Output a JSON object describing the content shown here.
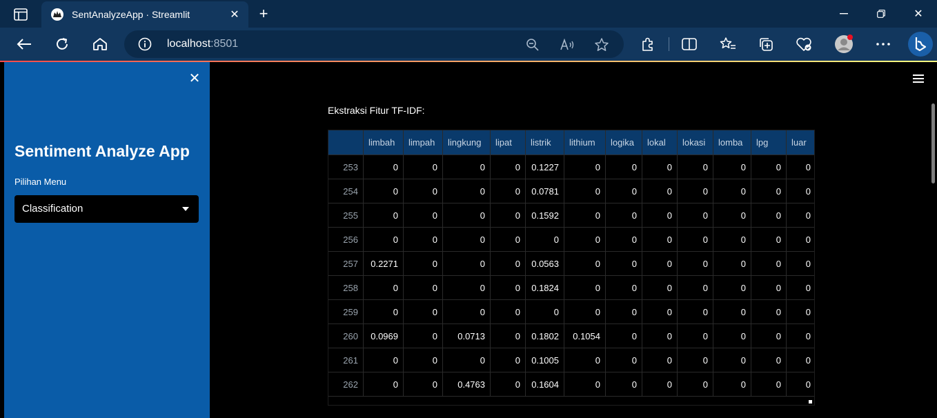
{
  "browser": {
    "tab_title": "SentAnalyzeApp · Streamlit",
    "url_host": "localhost",
    "url_port": ":8501"
  },
  "sidebar": {
    "title": "Sentiment Analyze App",
    "menu_label": "Pilihan Menu",
    "menu_selected": "Classification"
  },
  "main": {
    "section_title": "Ekstraksi Fitur TF-IDF:",
    "columns": [
      "",
      "limbah",
      "limpah",
      "lingkung",
      "lipat",
      "listrik",
      "lithium",
      "logika",
      "lokal",
      "lokasi",
      "lomba",
      "lpg",
      "luar"
    ],
    "rows": [
      [
        "253",
        "0",
        "0",
        "0",
        "0",
        "0.1227",
        "0",
        "0",
        "0",
        "0",
        "0",
        "0",
        "0"
      ],
      [
        "254",
        "0",
        "0",
        "0",
        "0",
        "0.0781",
        "0",
        "0",
        "0",
        "0",
        "0",
        "0",
        "0"
      ],
      [
        "255",
        "0",
        "0",
        "0",
        "0",
        "0.1592",
        "0",
        "0",
        "0",
        "0",
        "0",
        "0",
        "0"
      ],
      [
        "256",
        "0",
        "0",
        "0",
        "0",
        "0",
        "0",
        "0",
        "0",
        "0",
        "0",
        "0",
        "0"
      ],
      [
        "257",
        "0.2271",
        "0",
        "0",
        "0",
        "0.0563",
        "0",
        "0",
        "0",
        "0",
        "0",
        "0",
        "0"
      ],
      [
        "258",
        "0",
        "0",
        "0",
        "0",
        "0.1824",
        "0",
        "0",
        "0",
        "0",
        "0",
        "0",
        "0"
      ],
      [
        "259",
        "0",
        "0",
        "0",
        "0",
        "0",
        "0",
        "0",
        "0",
        "0",
        "0",
        "0",
        "0"
      ],
      [
        "260",
        "0.0969",
        "0",
        "0.0713",
        "0",
        "0.1802",
        "0.1054",
        "0",
        "0",
        "0",
        "0",
        "0",
        "0"
      ],
      [
        "261",
        "0",
        "0",
        "0",
        "0",
        "0.1005",
        "0",
        "0",
        "0",
        "0",
        "0",
        "0",
        "0"
      ],
      [
        "262",
        "0",
        "0",
        "0.4763",
        "0",
        "0.1604",
        "0",
        "0",
        "0",
        "0",
        "0",
        "0",
        "0"
      ]
    ]
  },
  "colors": {
    "sidebar_bg": "#0a5ca8",
    "table_header_bg": "#0a3a6b",
    "browser_chrome": "#12375e"
  }
}
